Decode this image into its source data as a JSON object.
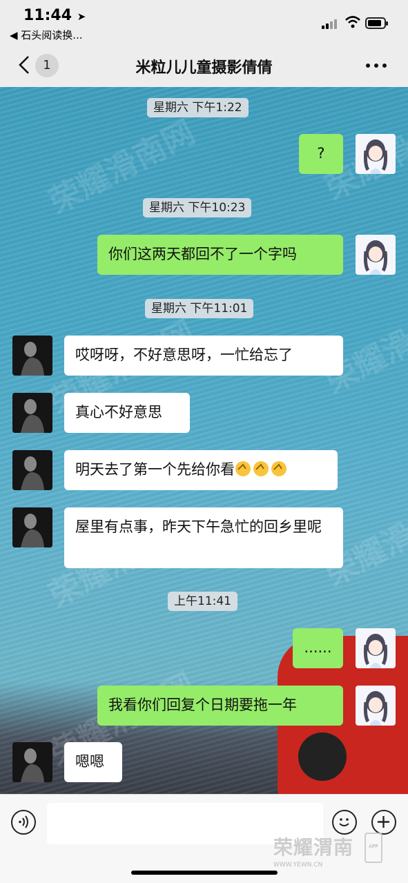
{
  "status_bar": {
    "time": "11:44",
    "back_app": "◀ 石头阅读换..."
  },
  "nav": {
    "back_count": "1",
    "title": "米粒儿儿童摄影倩倩"
  },
  "timestamps": [
    "星期六 下午1:22",
    "星期六 下午10:23",
    "星期六 下午11:01",
    "上午11:41"
  ],
  "messages": [
    {
      "side": "out",
      "text": "?"
    },
    {
      "side": "out",
      "text": "你们这两天都回不了一个字吗"
    },
    {
      "side": "in",
      "text": "哎呀呀，不好意思呀，一忙给忘了"
    },
    {
      "side": "in",
      "text": "真心不好意思"
    },
    {
      "side": "in",
      "text": "明天去了第一个先给你看"
    },
    {
      "side": "in",
      "text": "屋里有点事，昨天下午急忙的回乡里呢"
    },
    {
      "side": "out",
      "text": "......"
    },
    {
      "side": "out",
      "text": "我看你们回复个日期要拖一年"
    },
    {
      "side": "in",
      "text": "嗯嗯"
    }
  ],
  "watermark": {
    "text": "荣耀滑南网",
    "url": "WWW.YEWN.CN"
  },
  "brand": {
    "name": "荣耀渭南",
    "url": "WWW.YEWN.CN",
    "tag": "APP"
  }
}
